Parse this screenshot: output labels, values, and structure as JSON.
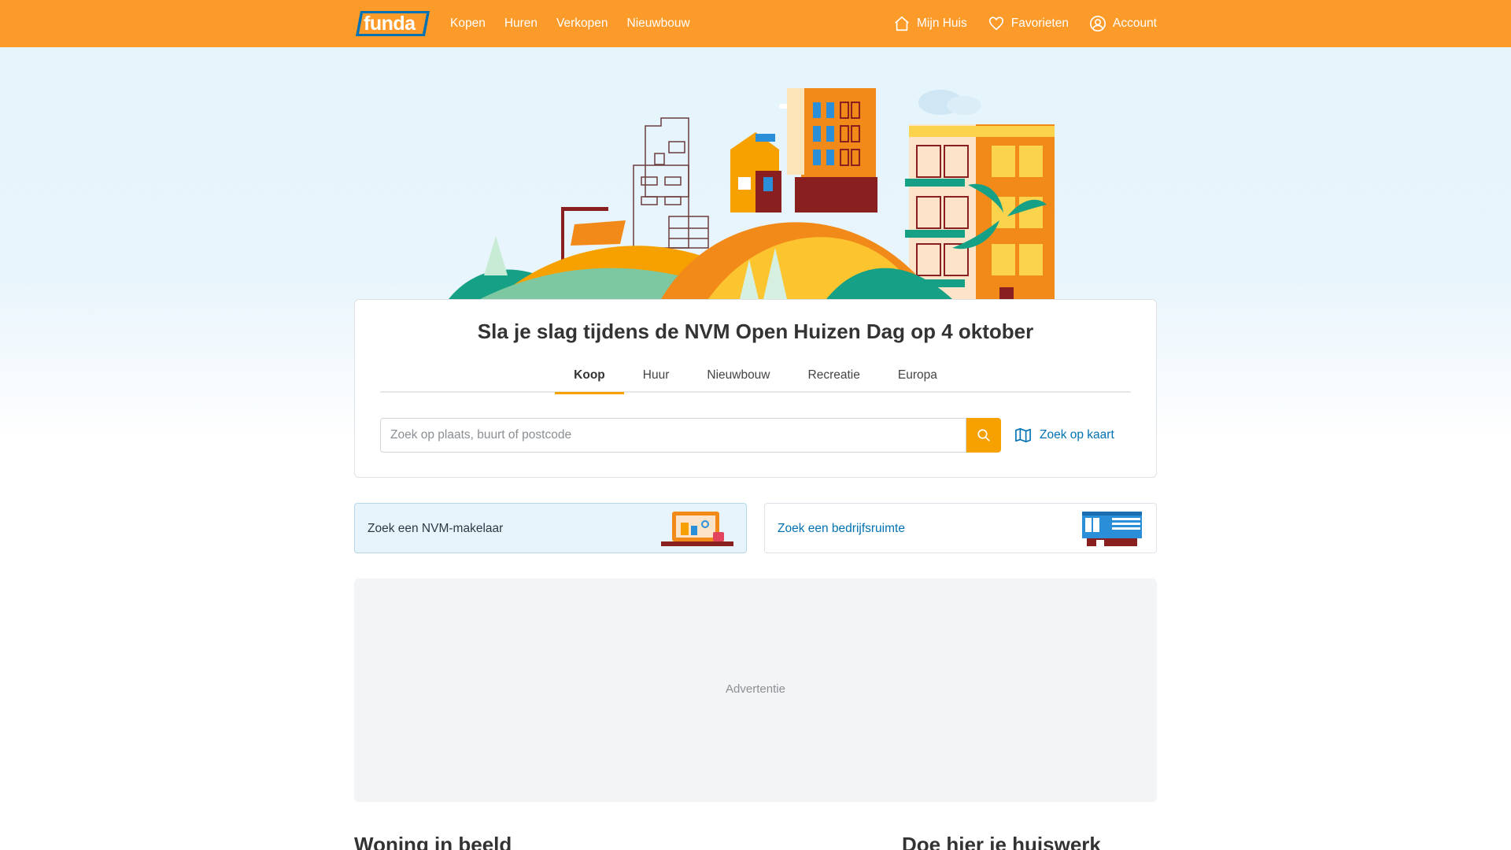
{
  "nav": {
    "logo_text": "funda",
    "links": [
      "Kopen",
      "Huren",
      "Verkopen",
      "Nieuwbouw"
    ],
    "right": {
      "mijn_huis": "Mijn Huis",
      "favorieten": "Favorieten",
      "account": "Account"
    }
  },
  "search": {
    "headline": "Sla je slag tijdens de NVM Open Huizen Dag op 4 oktober",
    "tabs": [
      "Koop",
      "Huur",
      "Nieuwbouw",
      "Recreatie",
      "Europa"
    ],
    "active_tab": "Koop",
    "placeholder": "Zoek op plaats, buurt of postcode",
    "value": "",
    "map_link": "Zoek op kaart"
  },
  "promos": {
    "makelaar": "Zoek een NVM-makelaar",
    "bedrijf": "Zoek een bedrijfsruimte"
  },
  "ad": {
    "label": "Advertentie"
  },
  "sections": {
    "left_title": "Woning in beeld",
    "right_title": "Doe hier je huiswerk"
  },
  "colors": {
    "brand_orange": "#fd9b2a",
    "search_orange": "#f7a100",
    "link_blue": "#0071b3"
  }
}
